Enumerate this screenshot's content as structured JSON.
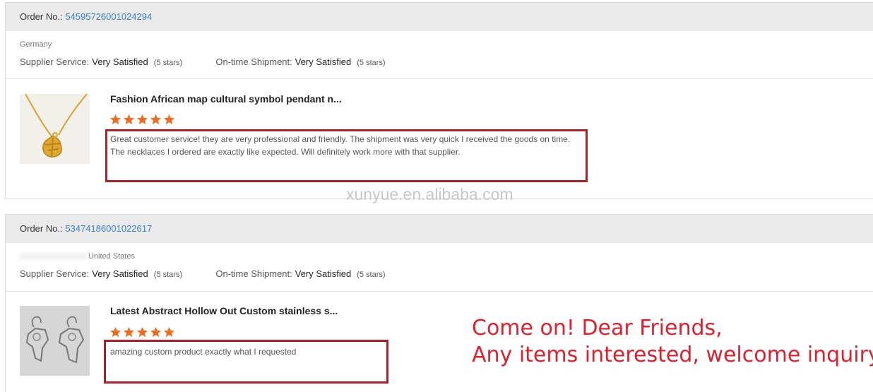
{
  "orders": [
    {
      "order_label": "Order No.:",
      "order_number": "54595726001024294",
      "buyer_country": "Germany",
      "supplier_service_label": "Supplier Service:",
      "supplier_service_value": "Very Satisfied",
      "supplier_service_stars": "(5 stars)",
      "shipment_label": "On-time Shipment:",
      "shipment_value": "Very Satisfied",
      "shipment_stars": "(5 stars)",
      "product_title": "Fashion African map cultural symbol pendant n...",
      "rating": 5,
      "review": "Great customer service! they are very professional and friendly. The shipment was very quick I received the goods on time. The necklaces I ordered are exactly like expected.  Will definitely work more with that supplier."
    },
    {
      "order_label": "Order No.:",
      "order_number": "53474186001022617",
      "buyer_country": "United States",
      "supplier_service_label": "Supplier Service:",
      "supplier_service_value": "Very Satisfied",
      "supplier_service_stars": "(5 stars)",
      "shipment_label": "On-time Shipment:",
      "shipment_value": "Very Satisfied",
      "shipment_stars": "(5 stars)",
      "product_title": "Latest Abstract Hollow Out Custom stainless s...",
      "rating": 5,
      "review": "amazing custom product exactly what I requested"
    }
  ],
  "watermark": "xunyue.en.alibaba.com",
  "promo": {
    "line1": "Come on! Dear Friends,",
    "line2": "Any items interested, welcome inquiry!"
  },
  "colors": {
    "order_number": "#3a7fc1",
    "star": "#f26b1d",
    "highlight_box": "#b21e24",
    "promo_text": "#e0202e"
  },
  "icons": {
    "star": "star-icon"
  }
}
